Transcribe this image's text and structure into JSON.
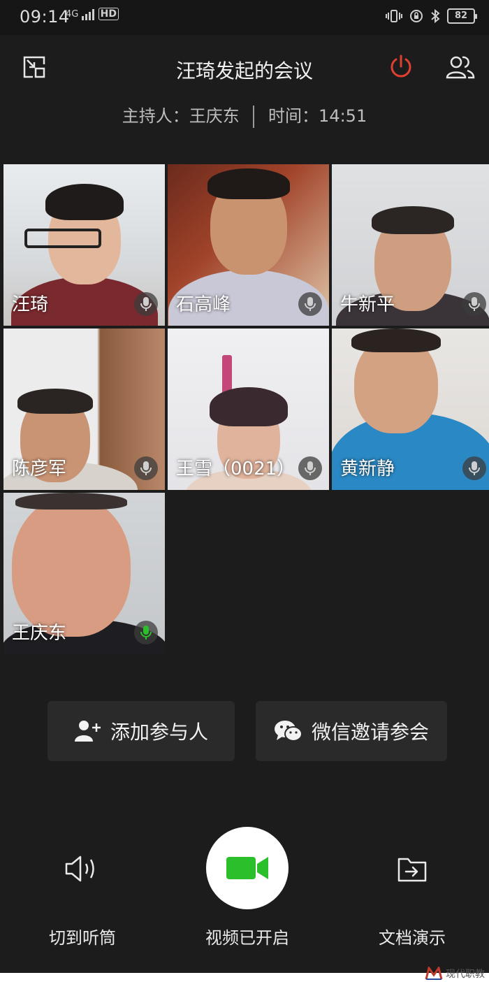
{
  "status_bar": {
    "time": "09:14",
    "network": "4G",
    "hd": "HD",
    "battery": "82"
  },
  "header": {
    "title": "汪琦发起的会议",
    "host_label": "主持人：王庆东",
    "time_label": "时间：14:51"
  },
  "participants": [
    {
      "name": "汪琦",
      "mic": "muted"
    },
    {
      "name": "石高峰",
      "mic": "muted"
    },
    {
      "name": "牛新平",
      "mic": "muted"
    },
    {
      "name": "陈彦军",
      "mic": "muted"
    },
    {
      "name": "王雪（0021）",
      "mic": "muted"
    },
    {
      "name": "黄新静",
      "mic": "muted"
    },
    {
      "name": "王庆东",
      "mic": "active"
    }
  ],
  "actions": {
    "add_participant": "添加参与人",
    "wechat_invite": "微信邀请参会"
  },
  "bottom_controls": {
    "earpiece": "切到听筒",
    "video": "视频已开启",
    "doc_share": "文档演示"
  },
  "colors": {
    "hangup": "#e04030",
    "video_on": "#2bc02b",
    "mic_active": "#2bc02b"
  },
  "watermark": "现代职教"
}
